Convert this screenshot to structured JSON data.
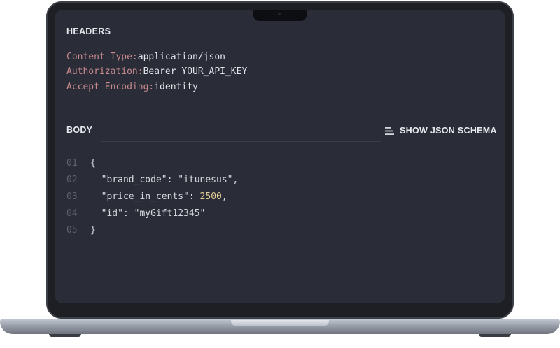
{
  "headers_section": {
    "title": "HEADERS",
    "lines": [
      {
        "key": "Content-Type:",
        "value": "application/json"
      },
      {
        "key": "Authorization:",
        "value": "Bearer YOUR_API_KEY"
      },
      {
        "key": "Accept-Encoding:",
        "value": "identity"
      }
    ]
  },
  "body_section": {
    "title": "BODY",
    "schema_button_label": "SHOW JSON SCHEMA",
    "schema_icon": "list-icon",
    "code": [
      {
        "line": "01",
        "text": "{"
      },
      {
        "line": "02",
        "text": "  \"brand_code\": \"itunesus\","
      },
      {
        "line": "03",
        "text": "  \"price_in_cents\": 2500,"
      },
      {
        "line": "04",
        "text": "  \"id\": \"myGift12345\""
      },
      {
        "line": "05",
        "text": "}"
      }
    ]
  },
  "colors": {
    "screen_bg": "#2a2d37",
    "header_key": "#c98a8f",
    "header_value": "#e2e4ea",
    "number": "#e6cf9a",
    "line_number": "#5d6270"
  }
}
